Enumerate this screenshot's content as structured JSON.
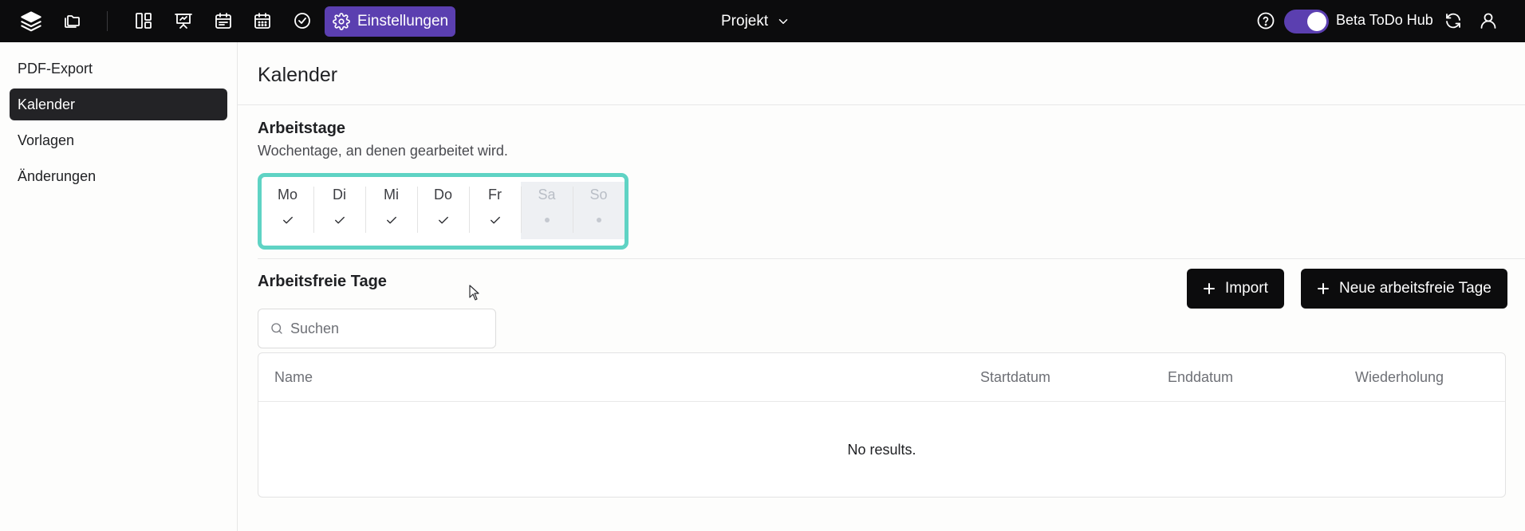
{
  "topbar": {
    "icons": [
      "layers-icon",
      "folders-icon",
      "board-icon",
      "presentation-icon",
      "calendar-icon",
      "calendar-grid-icon",
      "check-circle-icon"
    ],
    "settings_label": "Einstellungen",
    "project_label": "Projekt",
    "beta_label": "Beta ToDo Hub",
    "toggle_on": true,
    "accent_color": "#5b3fb0"
  },
  "sidebar": {
    "items": [
      {
        "label": "PDF-Export",
        "active": false
      },
      {
        "label": "Kalender",
        "active": true
      },
      {
        "label": "Vorlagen",
        "active": false
      },
      {
        "label": "Änderungen",
        "active": false
      }
    ]
  },
  "main": {
    "title": "Kalender",
    "workdays": {
      "title": "Arbeitstage",
      "subtitle": "Wochentage, an denen gearbeitet wird.",
      "highlight_color": "#5fd3c4",
      "days": [
        {
          "label": "Mo",
          "working": true
        },
        {
          "label": "Di",
          "working": true
        },
        {
          "label": "Mi",
          "working": true
        },
        {
          "label": "Do",
          "working": true
        },
        {
          "label": "Fr",
          "working": true
        },
        {
          "label": "Sa",
          "working": false
        },
        {
          "label": "So",
          "working": false
        }
      ]
    },
    "holidays": {
      "title": "Arbeitsfreie Tage",
      "import_label": "Import",
      "new_label": "Neue arbeitsfreie Tage",
      "search_placeholder": "Suchen",
      "columns": [
        "Name",
        "Startdatum",
        "Enddatum",
        "Wiederholung"
      ],
      "empty_text": "No results."
    }
  }
}
